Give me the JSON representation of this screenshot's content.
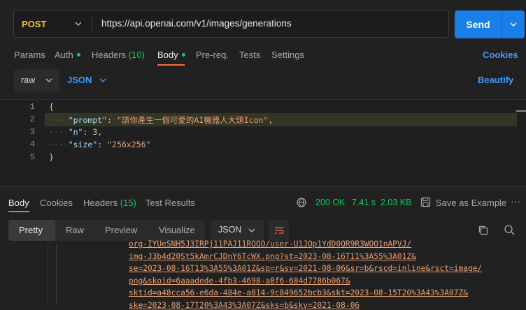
{
  "request": {
    "method": "POST",
    "url": "https://api.openai.com/v1/images/generations",
    "send_label": "Send"
  },
  "request_tabs": {
    "params": "Params",
    "auth": "Auth",
    "headers": "Headers",
    "headers_count": "(10)",
    "body": "Body",
    "prereq": "Pre-req.",
    "tests": "Tests",
    "settings": "Settings",
    "cookies": "Cookies"
  },
  "body_options": {
    "mode": "raw",
    "language": "JSON",
    "beautify": "Beautify"
  },
  "editor": {
    "line_numbers": [
      "1",
      "2",
      "3",
      "4",
      "5"
    ],
    "open_brace": "{",
    "close_brace": "}",
    "prompt_key": "\"prompt\"",
    "prompt_value": "\"請你產生一個可愛的AI機器人大頭Icon\"",
    "n_key": "\"n\"",
    "n_value": "3",
    "size_key": "\"size\"",
    "size_value": "\"256x256\""
  },
  "response": {
    "tabs": {
      "body": "Body",
      "cookies": "Cookies",
      "headers": "Headers",
      "headers_count": "(15)",
      "test_results": "Test Results"
    },
    "status": "200 OK",
    "time": "7.41 s",
    "size": "2.03 KB",
    "save_label": "Save as Example",
    "more": "···",
    "views": [
      "Pretty",
      "Raw",
      "Preview",
      "Visualize"
    ],
    "format": "JSON",
    "lines": [
      "org-IYUeSNH5J3IRPj11PAJ11RQQO/user-U1JOp1YdD0QR9R3WOO1nAPVJ/",
      "img-J3b4d20St5kAmrCJDnY6TcWX.png?st=2023-08-16T11%3A55%3A01Z&",
      "se=2023-08-16T13%3A55%3A01Z&sp=r&sv=2021-08-06&sr=b&rscd=inline&rsct=image/",
      "png&skoid=6aaadede-4fb3-4698-a8f6-684d7786b067&",
      "sktid=a48cca56-e6da-484e-a814-9c849652bcb3&skt=2023-08-15T20%3A43%3A07Z&",
      "ske=2023-08-17T20%3A43%3A07Z&sks=b&skv=2021-08-06"
    ]
  }
}
